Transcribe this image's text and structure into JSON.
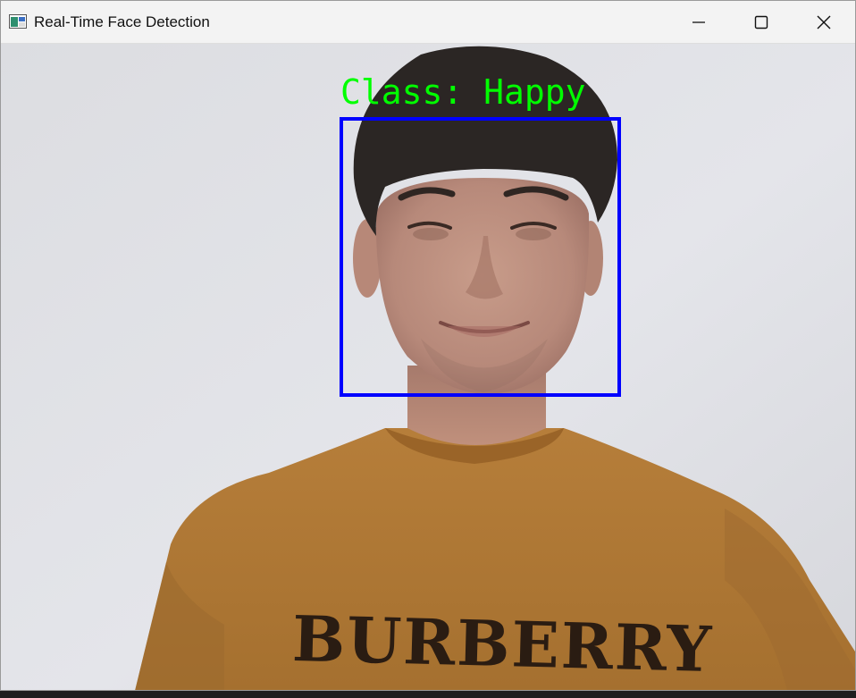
{
  "window": {
    "title": "Real-Time Face Detection",
    "controls": {
      "minimize": "minimize-icon",
      "maximize": "maximize-icon",
      "close": "close-icon"
    }
  },
  "video": {
    "detection_label": "Class: Happy",
    "label_color": "#00ff00",
    "box_color": "#0000ff",
    "shirt_print": "BURBERRY"
  }
}
